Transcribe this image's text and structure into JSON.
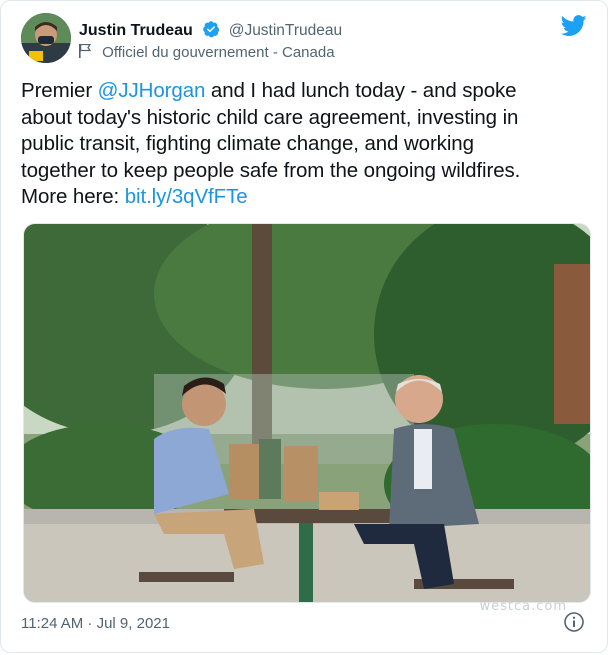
{
  "author": {
    "display_name": "Justin Trudeau",
    "handle": "@JustinTrudeau",
    "label": "Officiel du gouvernement - Canada",
    "verified": true,
    "avatar_icon": "avatar-photo",
    "label_icon": "flag-icon"
  },
  "tweet": {
    "lines": [
      {
        "prefix": "Premier ",
        "link": "@JJHorgan",
        "suffix": " and I had lunch today - and spoke"
      },
      {
        "prefix": "about today's historic child care agreement, investing in",
        "link": "",
        "suffix": ""
      },
      {
        "prefix": "public transit, fighting climate change, and working",
        "link": "",
        "suffix": ""
      },
      {
        "prefix": "together to keep people safe from the ongoing wildfires.",
        "link": "",
        "suffix": ""
      },
      {
        "prefix": "More here: ",
        "link": "bit.ly/3qVfFTe",
        "suffix": ""
      }
    ],
    "timestamp": "11:24 AM · Jul 9, 2021"
  },
  "watermark": "westca.com",
  "colors": {
    "link": "#1b95e0",
    "twitter_blue": "#1da1f2",
    "secondary_text": "#536471"
  },
  "icons": [
    "verified-badge-icon",
    "twitter-bird-icon",
    "flag-icon",
    "info-icon"
  ]
}
